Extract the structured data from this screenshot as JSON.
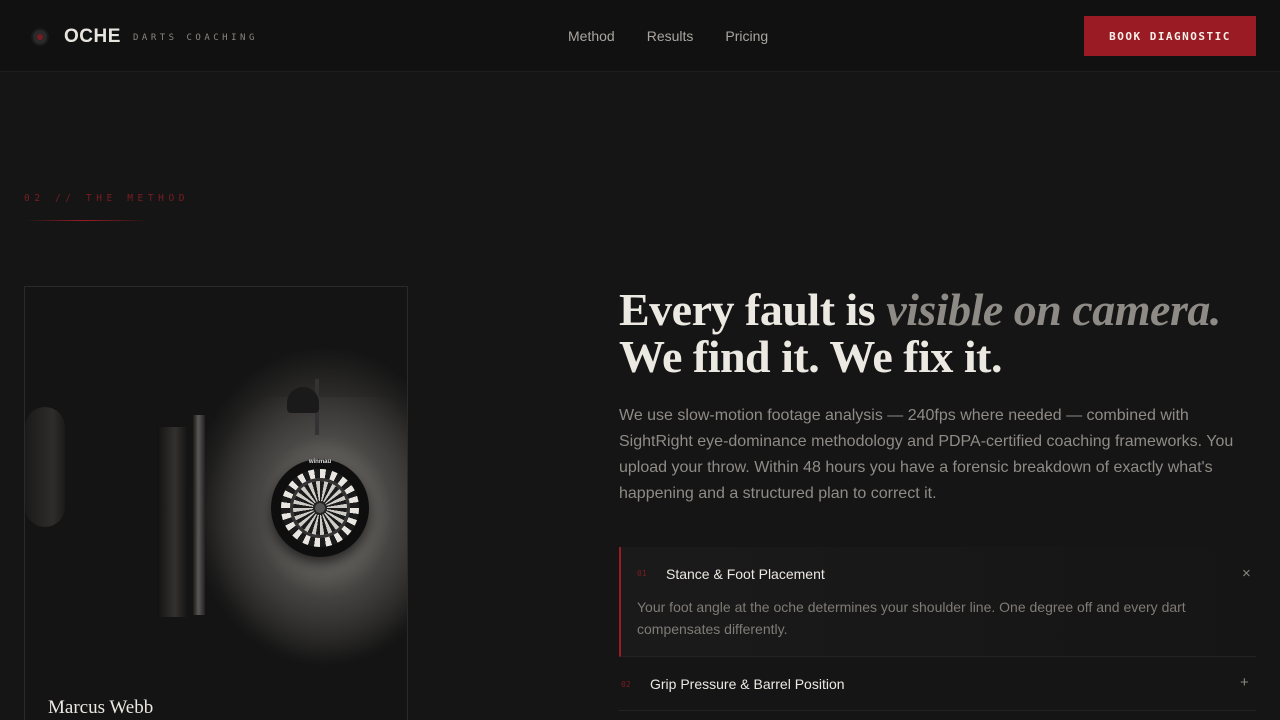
{
  "nav": {
    "brand": "OCHE",
    "brand_sub": "DARTS COACHING",
    "links": [
      "Method",
      "Results",
      "Pricing"
    ],
    "cta": "BOOK DIAGNOSTIC"
  },
  "section": {
    "label": "02 // THE METHOD"
  },
  "photo": {
    "caption": "Marcus Webb",
    "board_brand": "winmau"
  },
  "headline": {
    "part1": "Every fault is ",
    "emphasis": "visible on camera.",
    "line2": "We find it. We fix it."
  },
  "lead": "We use slow-motion footage analysis — 240fps where needed — combined with SightRight eye-dominance methodology and PDPA-certified coaching frameworks. You upload your throw. Within 48 hours you have a forensic breakdown of exactly what's happening and a structured plan to correct it.",
  "accordion": [
    {
      "num": "01",
      "title": "Stance & Foot Placement",
      "body": "Your foot angle at the oche determines your shoulder line. One degree off and every dart compensates differently.",
      "toggle": "×",
      "open": true
    },
    {
      "num": "02",
      "title": "Grip Pressure & Barrel Position",
      "toggle": "+",
      "open": false
    }
  ],
  "colors": {
    "accent": "#9b1b24",
    "background": "#151515",
    "nav_bg": "#111111"
  }
}
